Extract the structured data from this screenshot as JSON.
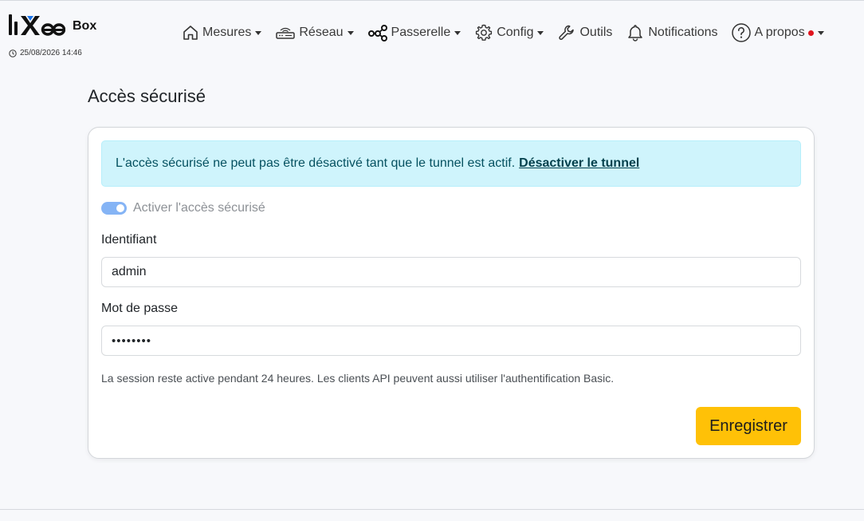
{
  "header": {
    "brand": {
      "logo_text": "liXee",
      "box_label": "Box"
    },
    "datetime": "25/08/2026 14:46",
    "icons": {
      "clock": "clock-icon",
      "mesures": "home-icon",
      "reseau": "router-icon",
      "passerelle": "network-nodes-icon",
      "config": "gear-icon",
      "outils": "wrench-icon",
      "notifications": "bell-icon",
      "apropos": "question-circle-icon"
    },
    "nav": {
      "mesures": "Mesures",
      "reseau": "Réseau",
      "passerelle": "Passerelle",
      "config": "Config",
      "outils": "Outils",
      "notifications": "Notifications",
      "apropos": "A propos"
    }
  },
  "page": {
    "title": "Accès sécurisé",
    "alert": {
      "text": "L'accès sécurisé ne peut pas être désactivé tant que le tunnel est actif.",
      "link": "Désactiver le tunnel"
    },
    "toggle": {
      "label": "Activer l'accès sécurisé",
      "checked": true,
      "disabled": true
    },
    "identifiant": {
      "label": "Identifiant",
      "value": "admin"
    },
    "password": {
      "label": "Mot de passe",
      "value": "••••••••"
    },
    "help": "La session reste active pendant 24 heures. Les clients API peuvent aussi utiliser l'authentification Basic.",
    "save_label": "Enregistrer"
  },
  "colors": {
    "accent_button": "#ffc107",
    "alert_bg": "#cff4fc",
    "toggle_on": "#7fb0f5",
    "notification_dot": "#e0141e",
    "logo_blue": "#1a73e8"
  }
}
